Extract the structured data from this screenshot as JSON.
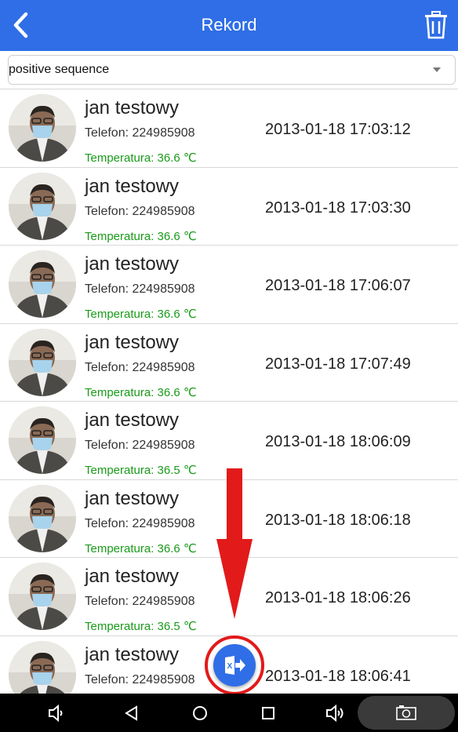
{
  "header": {
    "title": "Rekord",
    "back_icon": "chevron-left-icon",
    "trash_icon": "trash-icon",
    "background": "#2f6ee6"
  },
  "sort": {
    "selected": "positive sequence"
  },
  "records": [
    {
      "name": "jan testowy",
      "phone": "Telefon: 224985908",
      "temperature": "Temperatura: 36.6 ℃",
      "time": "2013-01-18 17:03:12"
    },
    {
      "name": "jan testowy",
      "phone": "Telefon: 224985908",
      "temperature": "Temperatura: 36.6 ℃",
      "time": "2013-01-18 17:03:30"
    },
    {
      "name": "jan testowy",
      "phone": "Telefon: 224985908",
      "temperature": "Temperatura: 36.6 ℃",
      "time": "2013-01-18 17:06:07"
    },
    {
      "name": "jan testowy",
      "phone": "Telefon: 224985908",
      "temperature": "Temperatura: 36.6 ℃",
      "time": "2013-01-18 17:07:49"
    },
    {
      "name": "jan testowy",
      "phone": "Telefon: 224985908",
      "temperature": "Temperatura: 36.5 ℃",
      "time": "2013-01-18 18:06:09"
    },
    {
      "name": "jan testowy",
      "phone": "Telefon: 224985908",
      "temperature": "Temperatura: 36.6 ℃",
      "time": "2013-01-18 18:06:18"
    },
    {
      "name": "jan testowy",
      "phone": "Telefon: 224985908",
      "temperature": "Temperatura: 36.5 ℃",
      "time": "2013-01-18 18:06:26"
    },
    {
      "name": "jan testowy",
      "phone": "Telefon: 224985908",
      "temperature": "",
      "time": "2013-01-18 18:06:41"
    }
  ],
  "colors": {
    "temperature": "#1a9a1a",
    "annotation": "#e21a1a"
  },
  "fab": {
    "icon": "excel-export-icon"
  },
  "nav": {
    "icons": [
      "volume-down-icon",
      "back-triangle-icon",
      "home-circle-icon",
      "recents-square-icon",
      "volume-up-icon",
      "camera-icon"
    ]
  }
}
